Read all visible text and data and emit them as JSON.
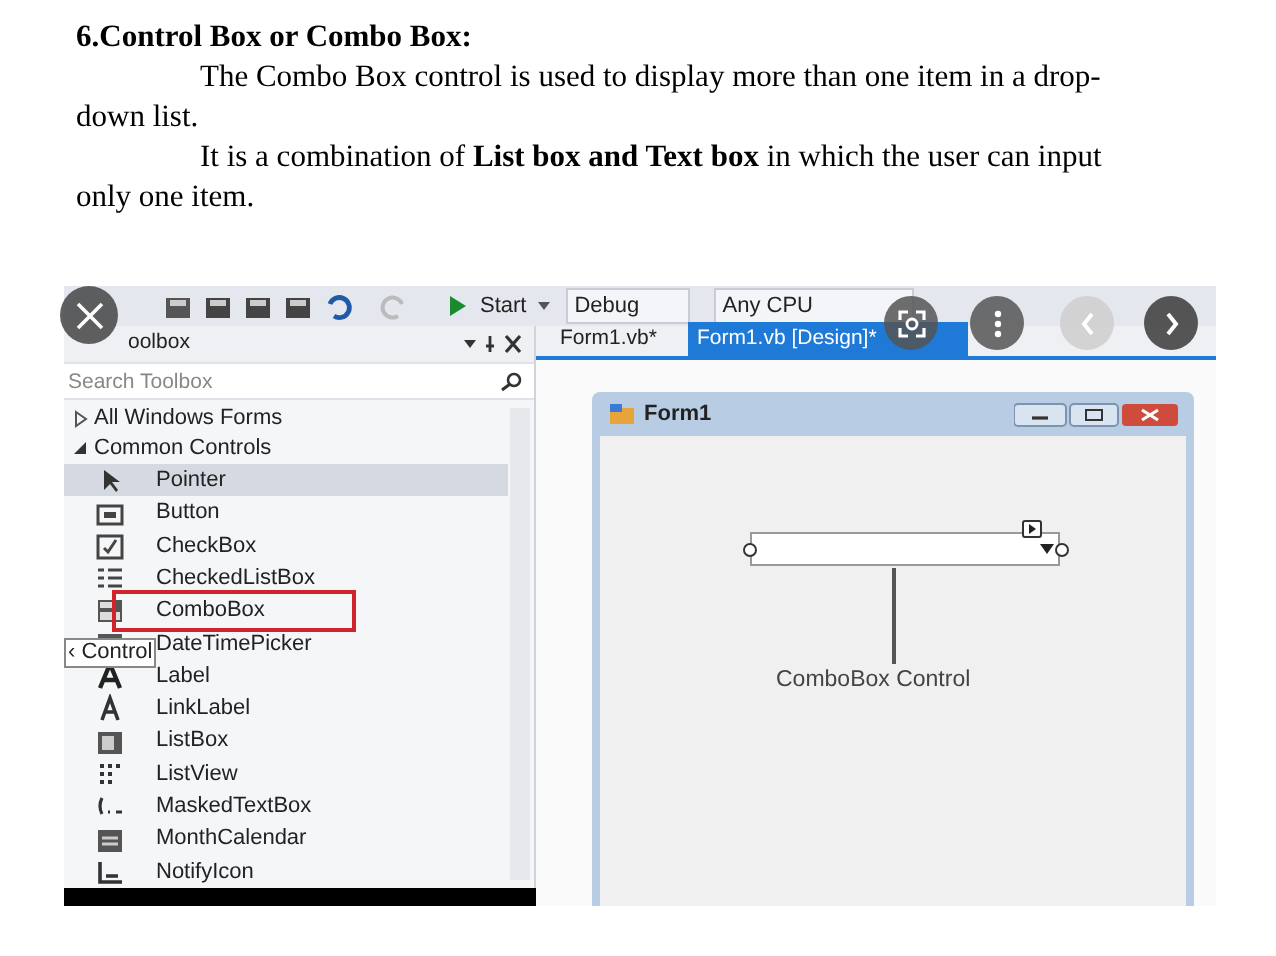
{
  "heading": "6.Control Box or Combo Box:",
  "paragraphs": [
    "The Combo Box control is used to display more than one item in a drop-down list.",
    "It is a combination of  **List box and Text box** in which the user can input only one item."
  ],
  "screenshot": {
    "toolbar": {
      "start": "Start",
      "configuration": "Debug",
      "platform": "Any CPU"
    },
    "toolbox": {
      "title": "oolbox",
      "search": {
        "placeholder": "Search Toolbox"
      },
      "groups": [
        {
          "label": "All Windows Forms",
          "expanded": false
        },
        {
          "label": "Common Controls",
          "expanded": true,
          "children": [
            {
              "label": "Pointer",
              "selected": true,
              "highlighted": false
            },
            {
              "label": "Button",
              "selected": false,
              "highlighted": false
            },
            {
              "label": "CheckBox",
              "selected": false,
              "highlighted": false
            },
            {
              "label": "CheckedListBox",
              "selected": false,
              "highlighted": false
            },
            {
              "label": "ComboBox",
              "selected": false,
              "highlighted": true
            },
            {
              "label": "DateTimePicker",
              "selected": false,
              "highlighted": false
            },
            {
              "label": "Label",
              "selected": false,
              "highlighted": false
            },
            {
              "label": "LinkLabel",
              "selected": false,
              "highlighted": false
            },
            {
              "label": "ListBox",
              "selected": false,
              "highlighted": false
            },
            {
              "label": "ListView",
              "selected": false,
              "highlighted": false
            },
            {
              "label": "MaskedTextBox",
              "selected": false,
              "highlighted": false
            },
            {
              "label": "MonthCalendar",
              "selected": false,
              "highlighted": false
            },
            {
              "label": "NotifyIcon",
              "selected": false,
              "highlighted": false
            }
          ]
        }
      ],
      "tooltip": "‹ Control"
    },
    "tabs": [
      {
        "label": "Form1.vb*",
        "selected": false
      },
      {
        "label": "Form1.vb [Design]*",
        "selected": true
      }
    ],
    "form": {
      "title": "Form1",
      "caption": "ComboBox Control"
    }
  }
}
